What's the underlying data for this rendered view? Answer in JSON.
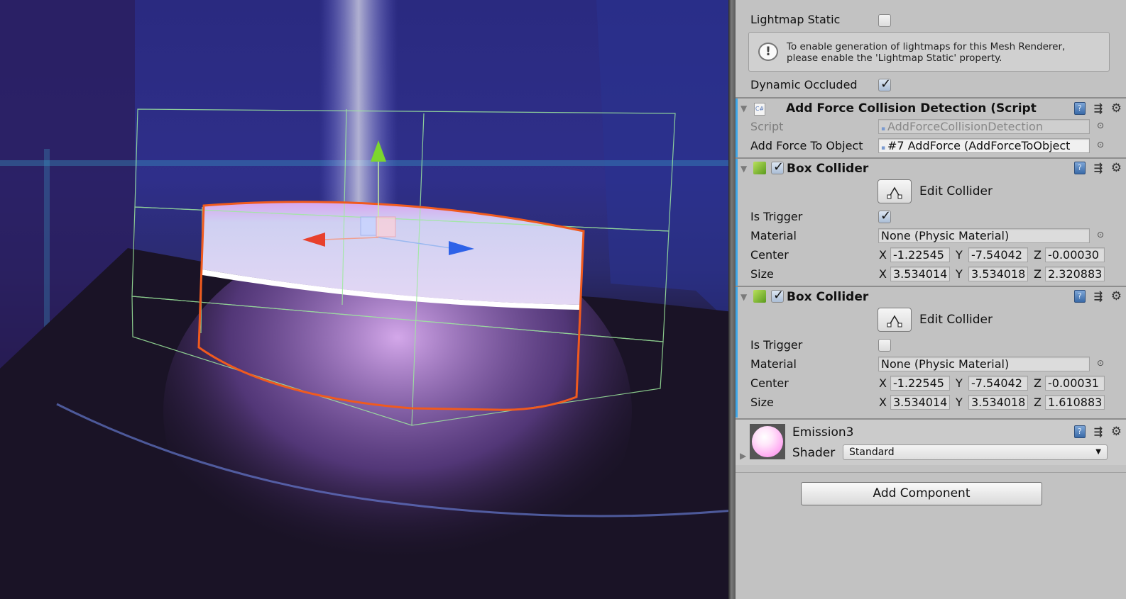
{
  "scene": {
    "gizmo_axes": [
      "x-axis-red",
      "y-axis-green",
      "z-axis-blue"
    ],
    "colors": {
      "selection_outline": "#f05a1e",
      "collider_wire": "#9eea9e",
      "x_axis": "#e8402c",
      "y_axis": "#7cd62e",
      "z_axis": "#2e62e8"
    }
  },
  "inspector": {
    "mesh_renderer": {
      "lightmap_static_label": "Lightmap Static",
      "lightmap_static": false,
      "info_icon": "exclamation-speech-icon",
      "info_line1": "To enable generation of lightmaps for this Mesh Renderer,",
      "info_line2": "please enable the 'Lightmap Static' property.",
      "dynamic_occluded_label": "Dynamic Occluded",
      "dynamic_occluded": true
    },
    "script_component": {
      "title": "Add Force Collision Detection (Script",
      "script_label": "Script",
      "script_value": "AddForceCollisionDetection",
      "target_label": "Add Force To Object",
      "target_value": "#7 AddForce (AddForceToObject"
    },
    "box_colliders": [
      {
        "title": "Box Collider",
        "enabled": true,
        "edit_label": "Edit Collider",
        "is_trigger_label": "Is Trigger",
        "is_trigger": true,
        "material_label": "Material",
        "material_value": "None (Physic Material)",
        "center_label": "Center",
        "center": {
          "x": "-1.22545",
          "y": "-7.54042",
          "z": "-0.00030"
        },
        "size_label": "Size",
        "size": {
          "x": "3.534014",
          "y": "3.534018",
          "z": "2.320883"
        }
      },
      {
        "title": "Box Collider",
        "enabled": true,
        "edit_label": "Edit Collider",
        "is_trigger_label": "Is Trigger",
        "is_trigger": false,
        "material_label": "Material",
        "material_value": "None (Physic Material)",
        "center_label": "Center",
        "center": {
          "x": "-1.22545",
          "y": "-7.54042",
          "z": "-0.00031"
        },
        "size_label": "Size",
        "size": {
          "x": "3.534014",
          "y": "3.534018",
          "z": "1.610883"
        }
      }
    ],
    "axis_labels": {
      "x": "X",
      "y": "Y",
      "z": "Z"
    },
    "material": {
      "name": "Emission3",
      "shader_label": "Shader",
      "shader_value": "Standard"
    },
    "add_component_label": "Add Component",
    "help_glyph": "?",
    "colors": {
      "panel_bg": "#c2c2c2",
      "accent_bar": "#3ea6e8"
    }
  }
}
